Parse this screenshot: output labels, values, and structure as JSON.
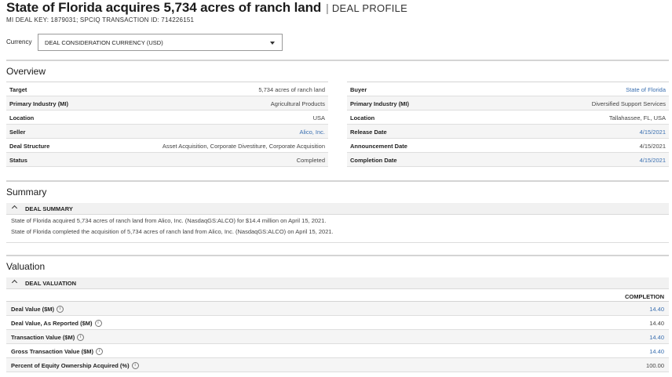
{
  "header": {
    "title": "State of Florida acquires 5,734 acres of ranch land",
    "separator": "|",
    "subtitle": "DEAL PROFILE",
    "keys": "MI DEAL KEY: 1879031; SPCIQ TRANSACTION ID: 714226151"
  },
  "currency": {
    "label": "Currency",
    "selected": "DEAL CONSIDERATION CURRENCY (USD)"
  },
  "overview": {
    "title": "Overview",
    "left": [
      {
        "label": "Target",
        "value": "5,734 acres of ranch land",
        "link": false
      },
      {
        "label": "Primary Industry (MI)",
        "value": "Agricultural Products",
        "link": false
      },
      {
        "label": "Location",
        "value": "USA",
        "link": false
      },
      {
        "label": "Seller",
        "value": "Alico, Inc.",
        "link": true
      },
      {
        "label": "Deal Structure",
        "value": "Asset Acquisition, Corporate Divestiture, Corporate Acquisition",
        "link": false
      },
      {
        "label": "Status",
        "value": "Completed",
        "link": false
      }
    ],
    "right": [
      {
        "label": "Buyer",
        "value": "State of Florida",
        "link": true
      },
      {
        "label": "Primary Industry (MI)",
        "value": "Diversified Support Services",
        "link": false
      },
      {
        "label": "Location",
        "value": "Tallahassee, FL, USA",
        "link": false
      },
      {
        "label": "Release Date",
        "value": "4/15/2021",
        "link": true
      },
      {
        "label": "Announcement Date",
        "value": "4/15/2021",
        "link": false
      },
      {
        "label": "Completion Date",
        "value": "4/15/2021",
        "link": true
      }
    ]
  },
  "summary": {
    "title": "Summary",
    "bar_label": "DEAL SUMMARY",
    "lines": [
      "State of Florida acquired 5,734 acres of ranch land from Alico, Inc. (NasdaqGS:ALCO) for $14.4 million on April 15, 2021.",
      "State of Florida completed the acquisition of 5,734 acres of ranch land from Alico, Inc. (NasdaqGS:ALCO) on April 15, 2021."
    ]
  },
  "valuation": {
    "title": "Valuation",
    "bar_label": "DEAL VALUATION",
    "column_header": "COMPLETION",
    "info_glyph": "i",
    "rows": [
      {
        "label": "Deal Value ($M)",
        "value": "14.40",
        "link": true
      },
      {
        "label": "Deal Value, As Reported ($M)",
        "value": "14.40",
        "link": false
      },
      {
        "label": "Transaction Value ($M)",
        "value": "14.40",
        "link": true
      },
      {
        "label": "Gross Transaction Value ($M)",
        "value": "14.40",
        "link": true
      },
      {
        "label": "Percent of Equity Ownership Acquired (%)",
        "value": "100.00",
        "link": false
      }
    ]
  },
  "colors": {
    "link": "#3a6fb0",
    "divider": "#d4d4d4",
    "row_alt": "#f5f5f5"
  }
}
